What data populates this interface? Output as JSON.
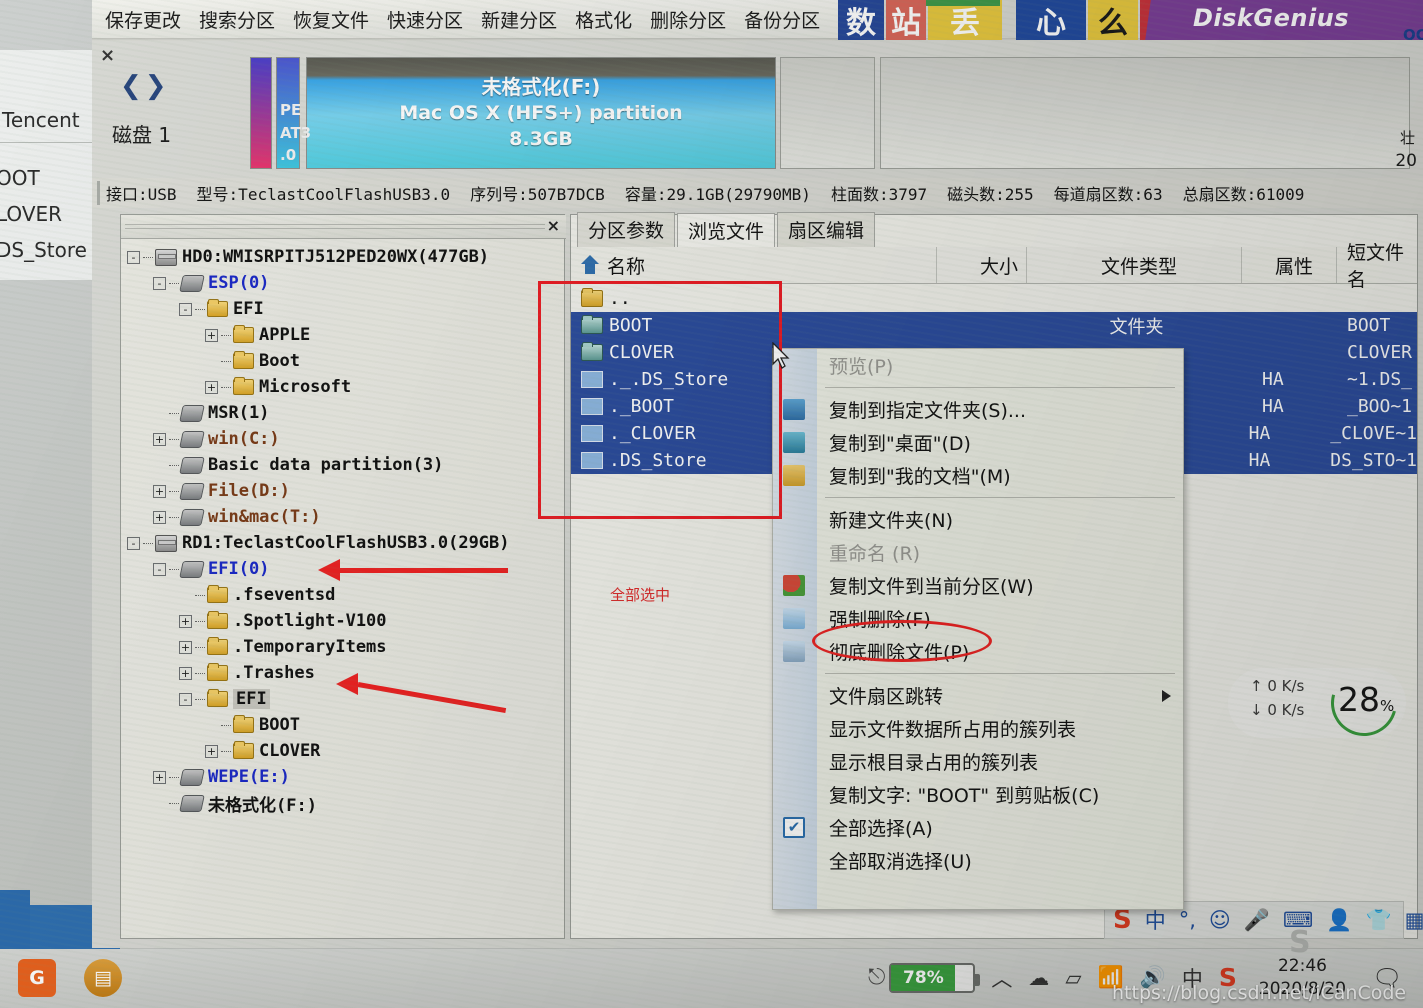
{
  "poster": {
    "brand": "DiskGenius",
    "qq": "QQ:",
    "tiles": [
      "数",
      "站",
      "丢",
      "心",
      "么",
      "!"
    ]
  },
  "tencent_fragment": {
    "title": "Tencent",
    "items": [
      "OOT",
      "LOVER",
      "DS_Store"
    ]
  },
  "toolbar": {
    "items": [
      "保存更改",
      "搜索分区",
      "恢复文件",
      "快速分区",
      "新建分区",
      "格式化",
      "删除分区",
      "备份分区"
    ]
  },
  "disk_area": {
    "close": "×",
    "nav_prev": "❮",
    "nav_next": "❯",
    "disk_label": "磁盘 1",
    "partitions": [
      {
        "name": "",
        "lines": []
      },
      {
        "name": "pe-partition",
        "lines": [
          "PE",
          "AT3",
          ".0"
        ]
      },
      {
        "name": "unformatted-f",
        "lines": [
          "未格式化(F:)",
          "Mac OS X (HFS+) partition",
          "8.3GB"
        ]
      },
      {
        "name": "blank-1",
        "lines": []
      },
      {
        "name": "blank-2",
        "lines": []
      }
    ],
    "right_edge_top": "壮",
    "right_edge_value": "20"
  },
  "info_bar": {
    "interface": "接口:USB",
    "model": "型号:TeclastCoolFlashUSB3.0",
    "serial": "序列号:507B7DCB",
    "capacity": "容量:29.1GB(29790MB)",
    "cylinders": "柱面数:3797",
    "heads": "磁头数:255",
    "sectors_per_track": "每道扇区数:63",
    "total_sectors": "总扇区数:61009"
  },
  "tree": {
    "close": "×",
    "nodes": [
      {
        "indent": 0,
        "pm": "-",
        "icon": "disk",
        "label": "HD0:WMISRPITJ512PED20WX(477GB)",
        "style": "black-bold"
      },
      {
        "indent": 1,
        "pm": "-",
        "icon": "part",
        "label": "ESP(0)",
        "style": "blue-bold"
      },
      {
        "indent": 2,
        "pm": "-",
        "icon": "folder",
        "label": "EFI",
        "style": "black-bold"
      },
      {
        "indent": 3,
        "pm": "+",
        "icon": "folder",
        "label": "APPLE",
        "style": "black-bold"
      },
      {
        "indent": 3,
        "pm": "",
        "icon": "folder",
        "label": "Boot",
        "style": "black-bold"
      },
      {
        "indent": 3,
        "pm": "+",
        "icon": "folder",
        "label": "Microsoft",
        "style": "black-bold"
      },
      {
        "indent": 1,
        "pm": "",
        "icon": "part",
        "label": "MSR(1)",
        "style": "black-bold"
      },
      {
        "indent": 1,
        "pm": "+",
        "icon": "part",
        "label": "win(C:)",
        "style": "brown-bold"
      },
      {
        "indent": 1,
        "pm": "",
        "icon": "part",
        "label": "Basic data partition(3)",
        "style": "black-bold"
      },
      {
        "indent": 1,
        "pm": "+",
        "icon": "part",
        "label": "File(D:)",
        "style": "brown-bold"
      },
      {
        "indent": 1,
        "pm": "+",
        "icon": "part",
        "label": "win&mac(T:)",
        "style": "brown-bold"
      },
      {
        "indent": 0,
        "pm": "-",
        "icon": "disk",
        "label": "RD1:TeclastCoolFlashUSB3.0(29GB)",
        "style": "black-bold"
      },
      {
        "indent": 1,
        "pm": "-",
        "icon": "part",
        "label": "EFI(0)",
        "style": "blue-bold"
      },
      {
        "indent": 2,
        "pm": "",
        "icon": "folder",
        "label": ".fseventsd",
        "style": "black-bold"
      },
      {
        "indent": 2,
        "pm": "+",
        "icon": "folder",
        "label": ".Spotlight-V100",
        "style": "black-bold"
      },
      {
        "indent": 2,
        "pm": "+",
        "icon": "folder",
        "label": ".TemporaryItems",
        "style": "black-bold"
      },
      {
        "indent": 2,
        "pm": "+",
        "icon": "folder",
        "label": ".Trashes",
        "style": "black-bold"
      },
      {
        "indent": 2,
        "pm": "-",
        "icon": "folder",
        "label": "EFI",
        "style": "black-bold",
        "selected": true
      },
      {
        "indent": 3,
        "pm": "",
        "icon": "folder",
        "label": "BOOT",
        "style": "black-bold"
      },
      {
        "indent": 3,
        "pm": "+",
        "icon": "folder",
        "label": "CLOVER",
        "style": "black-bold"
      },
      {
        "indent": 1,
        "pm": "+",
        "icon": "part",
        "label": "WEPE(E:)",
        "style": "blue-bold"
      },
      {
        "indent": 1,
        "pm": "",
        "icon": "part",
        "label": "未格式化(F:)",
        "style": "black-bold"
      }
    ]
  },
  "content": {
    "tabs": [
      {
        "label": "分区参数",
        "active": false
      },
      {
        "label": "浏览文件",
        "active": true
      },
      {
        "label": "扇区编辑",
        "active": false
      }
    ],
    "columns": [
      "名称",
      "大小",
      "文件类型",
      "属性",
      "短文件名"
    ],
    "rows": [
      {
        "icon": "folder",
        "name": "..",
        "size": "",
        "type": "",
        "attr": "",
        "short": "",
        "selected": false
      },
      {
        "icon": "folder",
        "name": "BOOT",
        "size": "",
        "type": "文件夹",
        "attr": "",
        "short": "BOOT",
        "selected": true
      },
      {
        "icon": "folder",
        "name": "CLOVER",
        "size": "",
        "type": "",
        "attr": "",
        "short": "CLOVER",
        "selected": true
      },
      {
        "icon": "file",
        "name": "._.DS_Store",
        "size": "",
        "type": "",
        "attr": "HA",
        "short": "~1.DS_",
        "selected": true
      },
      {
        "icon": "file",
        "name": "._BOOT",
        "size": "",
        "type": "",
        "attr": "HA",
        "short": "_BOO~1",
        "selected": true
      },
      {
        "icon": "file",
        "name": "._CLOVER",
        "size": "",
        "type": "",
        "attr": "HA",
        "short": "_CLOVE~1",
        "selected": true
      },
      {
        "icon": "file",
        "name": ".DS_Store",
        "size": "",
        "type": "",
        "attr": "HA",
        "short": "DS_STO~1",
        "selected": true
      }
    ]
  },
  "annotations": {
    "all_selected": "全部选中"
  },
  "context_menu": {
    "items": [
      {
        "label": "预览(P)",
        "disabled": true,
        "icon": "none"
      },
      {
        "sep": true
      },
      {
        "label": "复制到指定文件夹(S)...",
        "disabled": false,
        "icon": "copy-folder"
      },
      {
        "label": "复制到\"桌面\"(D)",
        "disabled": false,
        "icon": "copy-desktop"
      },
      {
        "label": "复制到\"我的文档\"(M)",
        "disabled": false,
        "icon": "copy-docs"
      },
      {
        "sep": true
      },
      {
        "label": "新建文件夹(N)",
        "disabled": false,
        "icon": "none"
      },
      {
        "label": "重命名 (R)",
        "disabled": true,
        "icon": "none"
      },
      {
        "label": "复制文件到当前分区(W)",
        "disabled": false,
        "icon": "pie"
      },
      {
        "label": "强制删除(F)",
        "disabled": false,
        "icon": "force-delete"
      },
      {
        "label": "彻底删除文件(P)",
        "disabled": false,
        "icon": "wipe"
      },
      {
        "sep": true
      },
      {
        "label": "文件扇区跳转",
        "disabled": false,
        "icon": "none",
        "submenu": true
      },
      {
        "label": "显示文件数据所占用的簇列表",
        "disabled": false,
        "icon": "none"
      },
      {
        "label": "显示根目录占用的簇列表",
        "disabled": false,
        "icon": "none"
      },
      {
        "label": "复制文字: \"BOOT\" 到剪贴板(C)",
        "disabled": false,
        "icon": "none"
      },
      {
        "label": "全部选择(A)",
        "disabled": false,
        "icon": "checkbox"
      },
      {
        "label": "全部取消选择(U)",
        "disabled": false,
        "icon": "none"
      }
    ]
  },
  "speed_widget": {
    "upload": "↑ 0  K/s",
    "download": "↓ 0  K/s",
    "percent": "28",
    "percent_unit": "%"
  },
  "ime_bar": {
    "logo": "S",
    "mode": "中",
    "punct": "°,",
    "emoji": "☺",
    "mic": "🎤",
    "keyboard": "⌨",
    "user": "👤",
    "skin": "👕",
    "apps": "▦"
  },
  "taskbar": {
    "left_icons": [
      "sogou-browser-icon",
      "explorer-icon"
    ],
    "battery_percent": "78%",
    "plug": "🔌",
    "chevron": "︿",
    "cloud": "☁",
    "onedrive": "▱",
    "wifi": "📶",
    "volume": "🔊",
    "ime": "中",
    "sogou": "S",
    "time": "22:46",
    "date": "2020/8/20",
    "notification": "🗨"
  },
  "watermark": "https://blog.csdn.net/iCanCode"
}
